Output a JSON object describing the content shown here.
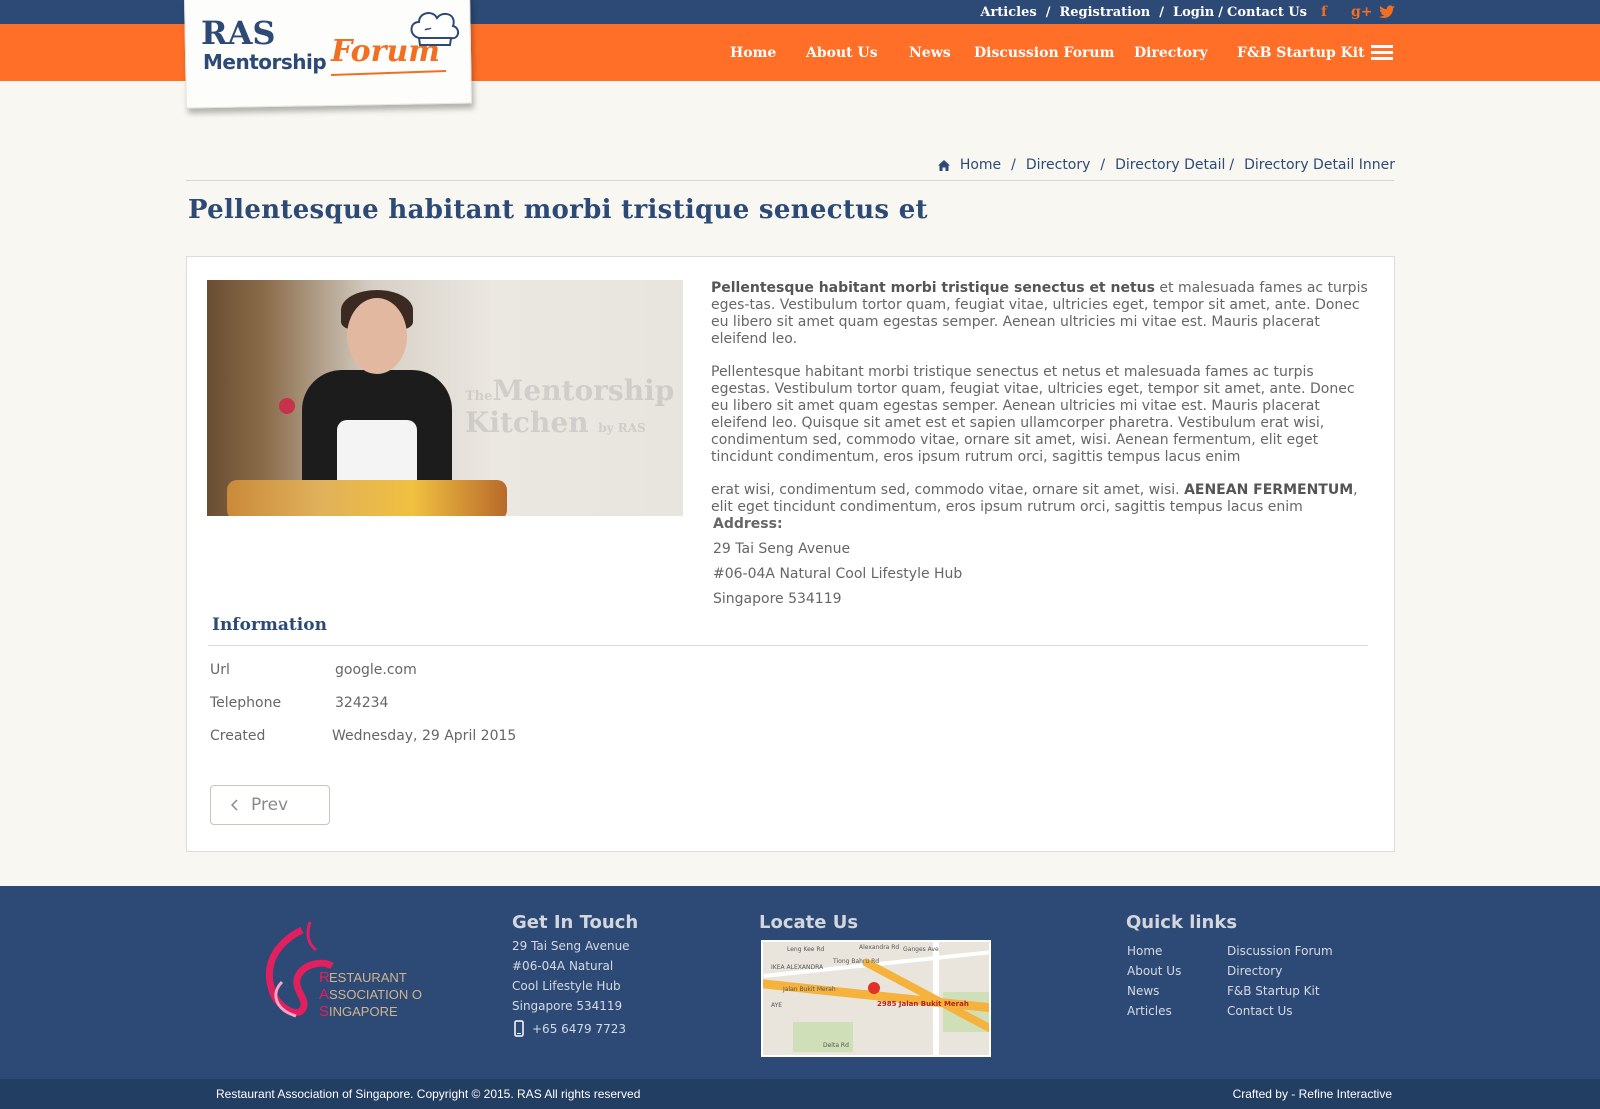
{
  "topbar": {
    "links": [
      "Articles",
      "Registration",
      "Login",
      "Contact Us"
    ],
    "social": [
      "facebook-icon",
      "google-plus-icon",
      "twitter-icon"
    ]
  },
  "logo": {
    "line1": "RAS",
    "line2": "Mentorship",
    "line3": "Forum"
  },
  "nav": [
    "Home",
    "About Us",
    "News",
    "Discussion Forum",
    "Directory",
    "F&B Startup Kit"
  ],
  "breadcrumb": [
    "Home",
    "Directory",
    "Directory Detail",
    "Directory Detail Inner"
  ],
  "page": {
    "title": "Pellentesque habitant morbi tristique senectus et"
  },
  "photo_watermark": {
    "small": "The",
    "line1": "Mentorship",
    "line2": "Kitchen",
    "by": "by RAS"
  },
  "description": {
    "p1_bold": "Pellentesque habitant morbi tristique senectus et netus",
    "p1_rest": " et malesuada fames ac turpis eges-tas. Vestibulum tortor quam, feugiat vitae, ultricies eget, tempor sit amet, ante. Donec eu libero sit amet quam egestas semper. Aenean ultricies mi vitae est. Mauris placerat eleifend leo.",
    "p2": "Pellentesque habitant morbi tristique senectus et netus et malesuada fames ac turpis egestas. Vestibulum tortor quam, feugiat vitae, ultricies eget, tempor sit amet, ante. Donec eu libero sit amet quam egestas semper. Aenean ultricies mi vitae est. Mauris placerat eleifend leo. Quisque sit amet est et sapien ullamcorper pharetra. Vestibulum erat wisi, condimentum sed, commodo vitae, ornare sit amet, wisi. Aenean fermentum, elit eget tincidunt condimentum, eros ipsum rutrum orci, sagittis tempus lacus enim",
    "p3_start": "erat wisi, condimentum sed, commodo vitae, ornare sit amet, wisi. ",
    "p3_bold": "AENEAN FERMENTUM",
    "p3_end": ", elit eget tincidunt condimentum, eros ipsum rutrum orci, sagittis tempus lacus enim"
  },
  "address": {
    "label": "Address:",
    "lines": [
      "29 Tai Seng Avenue",
      "#06-04A Natural Cool Lifestyle Hub",
      "Singapore 534119"
    ]
  },
  "information": {
    "title": "Information",
    "rows": [
      {
        "label": "Url",
        "value": "google.com"
      },
      {
        "label": "Telephone",
        "value": "324234"
      },
      {
        "label": "Created",
        "value": "Wednesday, 29 April 2015"
      }
    ]
  },
  "prev_button": "Prev",
  "footer": {
    "org_logo": {
      "line1": "ESTAURANT",
      "line2": "SSOCIATION OF",
      "line3": "INGAPORE",
      "r": "R",
      "a": "A",
      "s": "S"
    },
    "get_in_touch": {
      "title": "Get In Touch",
      "lines": [
        "29 Tai Seng Avenue",
        "#06-04A Natural",
        "Cool Lifestyle Hub",
        "Singapore 534119"
      ],
      "phone": "+65 6479 7723"
    },
    "locate_us": {
      "title": "Locate Us",
      "map_label": "2985 Jalan Bukit Merah",
      "map_streets": [
        "IKEA ALEXANDRA",
        "Alexandra Rd",
        "Jalan Bukit Merah",
        "Ganges Ave",
        "Leng Kee Rd",
        "Tiong Bahru Rd",
        "AYE",
        "Delta Rd"
      ]
    },
    "quick_links": {
      "title": "Quick links",
      "col1": [
        "Home",
        "About Us",
        "News",
        "Articles"
      ],
      "col2": [
        "Discussion Forum",
        "Directory",
        "F&B Startup Kit",
        "Contact Us"
      ]
    },
    "copyright": "Restaurant Association of Singapore. Copyright © 2015. RAS All rights reserved",
    "crafted": "Crafted by - Refine Interactive"
  },
  "colors": {
    "navy": "#2c4a75",
    "orange": "#ff6f28",
    "bg": "#f8f7f1"
  }
}
